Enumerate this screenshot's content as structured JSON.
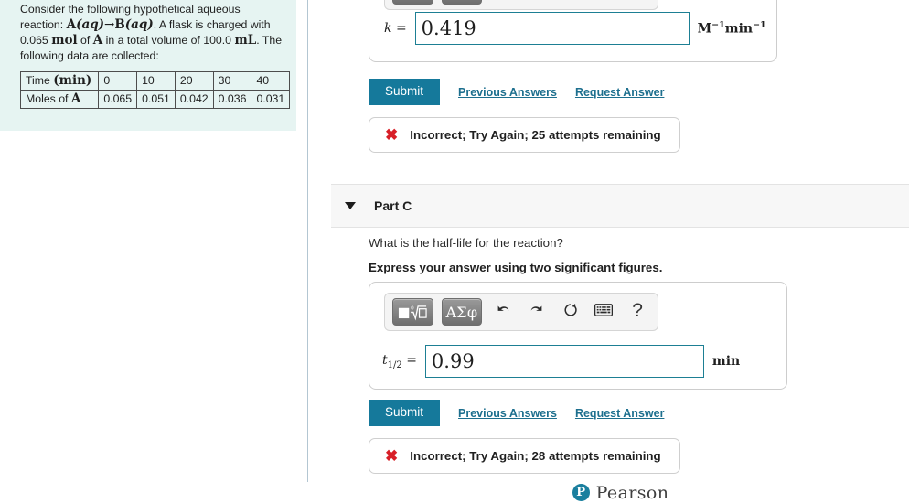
{
  "problem": {
    "intro_line1": "Consider the following hypothetical aqueous",
    "intro_line2_a": "reaction: ",
    "reaction_A": "A",
    "reaction_aq1": "(aq)",
    "reaction_arrow": "→",
    "reaction_B": "B",
    "reaction_aq2": "(aq)",
    "intro_line2_b": ". A flask is charged with",
    "amount": "0.065",
    "amount_unit": "mol",
    "of_word": " of ",
    "species": "A",
    "volume_text": " in a total volume of 100.0 ",
    "volume_unit": "mL",
    "intro_line3_tail": ". The",
    "intro_line4": "following data are collected:",
    "table": {
      "row_headers": [
        "Time",
        "Moles of"
      ],
      "time_unit": "(min)",
      "species_symbol": "A",
      "times": [
        "0",
        "10",
        "20",
        "30",
        "40"
      ],
      "moles": [
        "0.065",
        "0.051",
        "0.042",
        "0.036",
        "0.031"
      ]
    }
  },
  "palette": {
    "template_icon": "math-template-icon",
    "greek_label": "ΑΣφ",
    "undo_icon": "undo-arrow-icon",
    "redo_icon": "redo-arrow-icon",
    "reset_icon": "reset-circular-arrow-icon",
    "keyboard_icon": "keyboard-icon",
    "help_label": "?"
  },
  "part_b": {
    "answer_label": "k",
    "equals": "=",
    "answer_value": "0.419",
    "unit_m": "M",
    "unit_m_exp": "−1",
    "unit_min": "min",
    "unit_min_exp": "−1",
    "submit_label": "Submit",
    "previous_answers_label": "Previous Answers",
    "request_answer_label": "Request Answer",
    "feedback_icon": "red-x-icon",
    "feedback_text": "Incorrect; Try Again; 25 attempts remaining"
  },
  "part_c": {
    "caret_icon": "chevron-down-icon",
    "title": "Part C",
    "question": "What is the half-life for the reaction?",
    "instruction": "Express your answer using two significant figures.",
    "answer_label_base": "t",
    "answer_label_sub": "1/2",
    "equals": "=",
    "answer_value": "0.99",
    "unit": "min",
    "submit_label": "Submit",
    "previous_answers_label": "Previous Answers",
    "request_answer_label": "Request Answer",
    "feedback_icon": "red-x-icon",
    "feedback_text": "Incorrect; Try Again; 28 attempts remaining"
  },
  "footer": {
    "logo_letter": "P",
    "brand": "Pearson"
  },
  "colors": {
    "panel_bg": "#e6f4f2",
    "accent_teal": "#15799b",
    "input_border": "#1d7f94",
    "link": "#1d6f8e",
    "error_red": "#d81f27",
    "header_bg": "#f7f7f7"
  }
}
